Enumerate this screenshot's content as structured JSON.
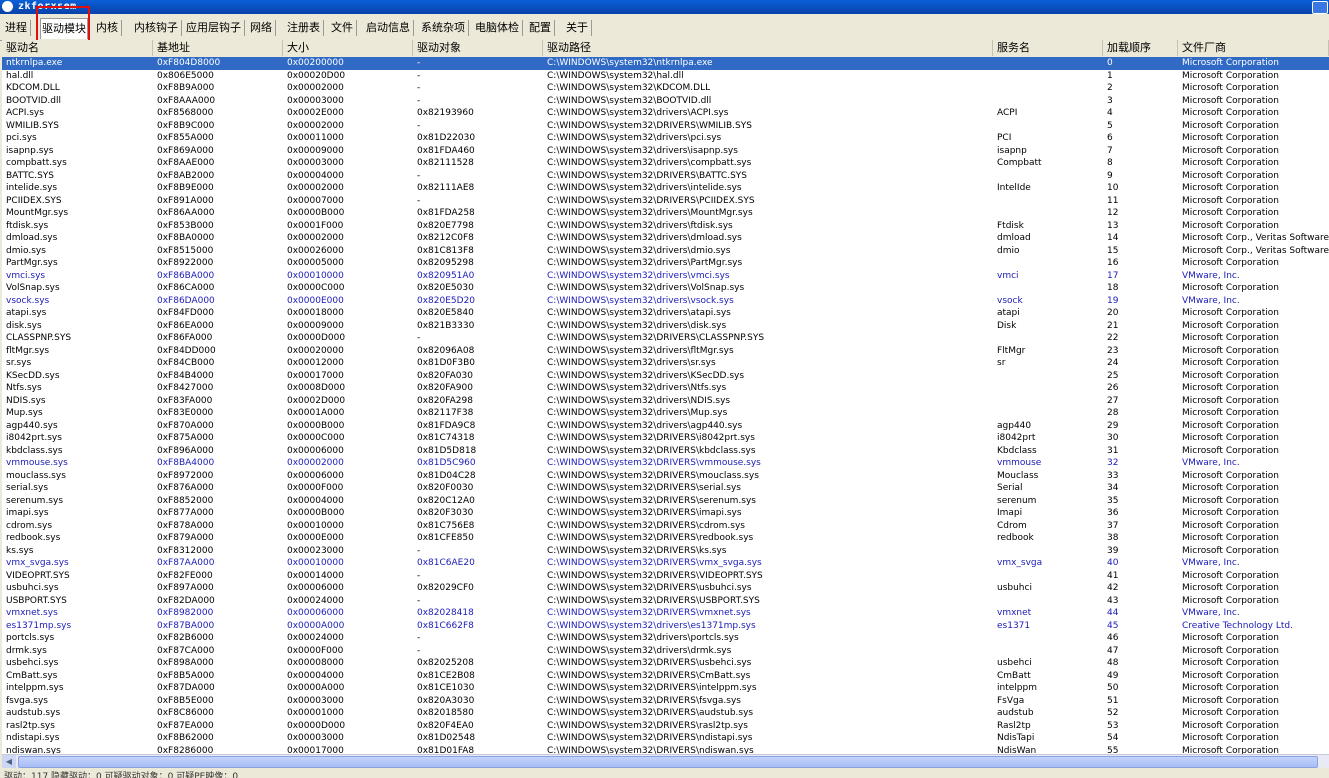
{
  "window": {
    "title": "zkforxsem"
  },
  "tabs": [
    "进程",
    "驱动模块",
    "内核",
    "内核钩子",
    "应用层钩子",
    "网络",
    "注册表",
    "文件",
    "启动信息",
    "系统杂项",
    "电脑体检",
    "配置",
    "关于"
  ],
  "active_tab": "驱动模块",
  "columns": [
    "驱动名",
    "基地址",
    "大小",
    "驱动对象",
    "驱动路径",
    "服务名",
    "加载顺序",
    "文件厂商"
  ],
  "rows": [
    [
      "ntkrnlpa.exe",
      "0xF804D8000",
      "0x00200000",
      "-",
      "C:\\WINDOWS\\system32\\ntkrnlpa.exe",
      "",
      "0",
      "Microsoft Corporation"
    ],
    [
      "hal.dll",
      "0x806E5000",
      "0x00020D00",
      "-",
      "C:\\WINDOWS\\system32\\hal.dll",
      "",
      "1",
      "Microsoft Corporation"
    ],
    [
      "KDCOM.DLL",
      "0xF8B9A000",
      "0x00002000",
      "-",
      "C:\\WINDOWS\\system32\\KDCOM.DLL",
      "",
      "2",
      "Microsoft Corporation"
    ],
    [
      "BOOTVID.dll",
      "0xF8AAA000",
      "0x00003000",
      "-",
      "C:\\WINDOWS\\system32\\BOOTVID.dll",
      "",
      "3",
      "Microsoft Corporation"
    ],
    [
      "ACPI.sys",
      "0xF8568000",
      "0x0002E000",
      "0x82193960",
      "C:\\WINDOWS\\system32\\drivers\\ACPI.sys",
      "ACPI",
      "4",
      "Microsoft Corporation"
    ],
    [
      "WMILIB.SYS",
      "0xF8B9C000",
      "0x00002000",
      "-",
      "C:\\WINDOWS\\system32\\DRIVERS\\WMILIB.SYS",
      "",
      "5",
      "Microsoft Corporation"
    ],
    [
      "pci.sys",
      "0xF855A000",
      "0x00011000",
      "0x81D22030",
      "C:\\WINDOWS\\system32\\drivers\\pci.sys",
      "PCI",
      "6",
      "Microsoft Corporation"
    ],
    [
      "isapnp.sys",
      "0xF869A000",
      "0x00009000",
      "0x81FDA460",
      "C:\\WINDOWS\\system32\\drivers\\isapnp.sys",
      "isapnp",
      "7",
      "Microsoft Corporation"
    ],
    [
      "compbatt.sys",
      "0xF8AAE000",
      "0x00003000",
      "0x82111528",
      "C:\\WINDOWS\\system32\\drivers\\compbatt.sys",
      "Compbatt",
      "8",
      "Microsoft Corporation"
    ],
    [
      "BATTC.SYS",
      "0xF8AB2000",
      "0x00004000",
      "-",
      "C:\\WINDOWS\\system32\\DRIVERS\\BATTC.SYS",
      "",
      "9",
      "Microsoft Corporation"
    ],
    [
      "intelide.sys",
      "0xF8B9E000",
      "0x00002000",
      "0x82111AE8",
      "C:\\WINDOWS\\system32\\drivers\\intelide.sys",
      "IntelIde",
      "10",
      "Microsoft Corporation"
    ],
    [
      "PCIIDEX.SYS",
      "0xF891A000",
      "0x00007000",
      "-",
      "C:\\WINDOWS\\system32\\DRIVERS\\PCIIDEX.SYS",
      "",
      "11",
      "Microsoft Corporation"
    ],
    [
      "MountMgr.sys",
      "0xF86AA000",
      "0x0000B000",
      "0x81FDA258",
      "C:\\WINDOWS\\system32\\drivers\\MountMgr.sys",
      "",
      "12",
      "Microsoft Corporation"
    ],
    [
      "ftdisk.sys",
      "0xF853B000",
      "0x0001F000",
      "0x820E7798",
      "C:\\WINDOWS\\system32\\drivers\\ftdisk.sys",
      "Ftdisk",
      "13",
      "Microsoft Corporation"
    ],
    [
      "dmload.sys",
      "0xF8BA0000",
      "0x00002000",
      "0x8212C0F8",
      "C:\\WINDOWS\\system32\\drivers\\dmload.sys",
      "dmload",
      "14",
      "Microsoft Corp., Veritas Software."
    ],
    [
      "dmio.sys",
      "0xF8515000",
      "0x00026000",
      "0x81C813F8",
      "C:\\WINDOWS\\system32\\drivers\\dmio.sys",
      "dmio",
      "15",
      "Microsoft Corp., Veritas Software"
    ],
    [
      "PartMgr.sys",
      "0xF8922000",
      "0x00005000",
      "0x82095298",
      "C:\\WINDOWS\\system32\\drivers\\PartMgr.sys",
      "",
      "16",
      "Microsoft Corporation"
    ],
    [
      "vmci.sys",
      "0xF86BA000",
      "0x00010000",
      "0x820951A0",
      "C:\\WINDOWS\\system32\\drivers\\vmci.sys",
      "vmci",
      "17",
      "VMware, Inc."
    ],
    [
      "VolSnap.sys",
      "0xF86CA000",
      "0x0000C000",
      "0x820E5030",
      "C:\\WINDOWS\\system32\\drivers\\VolSnap.sys",
      "",
      "18",
      "Microsoft Corporation"
    ],
    [
      "vsock.sys",
      "0xF86DA000",
      "0x0000E000",
      "0x820E5D20",
      "C:\\WINDOWS\\system32\\drivers\\vsock.sys",
      "vsock",
      "19",
      "VMware, Inc."
    ],
    [
      "atapi.sys",
      "0xF84FD000",
      "0x00018000",
      "0x820E5840",
      "C:\\WINDOWS\\system32\\drivers\\atapi.sys",
      "atapi",
      "20",
      "Microsoft Corporation"
    ],
    [
      "disk.sys",
      "0xF86EA000",
      "0x00009000",
      "0x821B3330",
      "C:\\WINDOWS\\system32\\drivers\\disk.sys",
      "Disk",
      "21",
      "Microsoft Corporation"
    ],
    [
      "CLASSPNP.SYS",
      "0xF86FA000",
      "0x0000D000",
      "-",
      "C:\\WINDOWS\\system32\\DRIVERS\\CLASSPNP.SYS",
      "",
      "22",
      "Microsoft Corporation"
    ],
    [
      "fltMgr.sys",
      "0xF84DD000",
      "0x00020000",
      "0x82096A08",
      "C:\\WINDOWS\\system32\\drivers\\fltMgr.sys",
      "FltMgr",
      "23",
      "Microsoft Corporation"
    ],
    [
      "sr.sys",
      "0xF84CB000",
      "0x00012000",
      "0x81D0F3B0",
      "C:\\WINDOWS\\system32\\drivers\\sr.sys",
      "sr",
      "24",
      "Microsoft Corporation"
    ],
    [
      "KSecDD.sys",
      "0xF84B4000",
      "0x00017000",
      "0x820FA030",
      "C:\\WINDOWS\\system32\\drivers\\KSecDD.sys",
      "",
      "25",
      "Microsoft Corporation"
    ],
    [
      "Ntfs.sys",
      "0xF8427000",
      "0x0008D000",
      "0x820FA900",
      "C:\\WINDOWS\\system32\\drivers\\Ntfs.sys",
      "",
      "26",
      "Microsoft Corporation"
    ],
    [
      "NDIS.sys",
      "0xF83FA000",
      "0x0002D000",
      "0x820FA298",
      "C:\\WINDOWS\\system32\\drivers\\NDIS.sys",
      "",
      "27",
      "Microsoft Corporation"
    ],
    [
      "Mup.sys",
      "0xF83E0000",
      "0x0001A000",
      "0x82117F38",
      "C:\\WINDOWS\\system32\\drivers\\Mup.sys",
      "",
      "28",
      "Microsoft Corporation"
    ],
    [
      "agp440.sys",
      "0xF870A000",
      "0x0000B000",
      "0x81FDA9C8",
      "C:\\WINDOWS\\system32\\drivers\\agp440.sys",
      "agp440",
      "29",
      "Microsoft Corporation"
    ],
    [
      "i8042prt.sys",
      "0xF875A000",
      "0x0000C000",
      "0x81C74318",
      "C:\\WINDOWS\\system32\\DRIVERS\\i8042prt.sys",
      "i8042prt",
      "30",
      "Microsoft Corporation"
    ],
    [
      "kbdclass.sys",
      "0xF896A000",
      "0x00006000",
      "0x81D5D818",
      "C:\\WINDOWS\\system32\\DRIVERS\\kbdclass.sys",
      "Kbdclass",
      "31",
      "Microsoft Corporation"
    ],
    [
      "vmmouse.sys",
      "0xF8BA4000",
      "0x00002000",
      "0x81D5C960",
      "C:\\WINDOWS\\system32\\DRIVERS\\vmmouse.sys",
      "vmmouse",
      "32",
      "VMware, Inc."
    ],
    [
      "mouclass.sys",
      "0xF8972000",
      "0x00006000",
      "0x81D04C28",
      "C:\\WINDOWS\\system32\\DRIVERS\\mouclass.sys",
      "Mouclass",
      "33",
      "Microsoft Corporation"
    ],
    [
      "serial.sys",
      "0xF876A000",
      "0x0000F000",
      "0x820F0030",
      "C:\\WINDOWS\\system32\\DRIVERS\\serial.sys",
      "Serial",
      "34",
      "Microsoft Corporation"
    ],
    [
      "serenum.sys",
      "0xF8852000",
      "0x00004000",
      "0x820C12A0",
      "C:\\WINDOWS\\system32\\DRIVERS\\serenum.sys",
      "serenum",
      "35",
      "Microsoft Corporation"
    ],
    [
      "imapi.sys",
      "0xF877A000",
      "0x0000B000",
      "0x820F3030",
      "C:\\WINDOWS\\system32\\DRIVERS\\imapi.sys",
      "Imapi",
      "36",
      "Microsoft Corporation"
    ],
    [
      "cdrom.sys",
      "0xF878A000",
      "0x00010000",
      "0x81C756E8",
      "C:\\WINDOWS\\system32\\DRIVERS\\cdrom.sys",
      "Cdrom",
      "37",
      "Microsoft Corporation"
    ],
    [
      "redbook.sys",
      "0xF879A000",
      "0x0000E000",
      "0x81CFE850",
      "C:\\WINDOWS\\system32\\DRIVERS\\redbook.sys",
      "redbook",
      "38",
      "Microsoft Corporation"
    ],
    [
      "ks.sys",
      "0xF8312000",
      "0x00023000",
      "-",
      "C:\\WINDOWS\\system32\\DRIVERS\\ks.sys",
      "",
      "39",
      "Microsoft Corporation"
    ],
    [
      "vmx_svga.sys",
      "0xF87AA000",
      "0x00010000",
      "0x81C6AE20",
      "C:\\WINDOWS\\system32\\DRIVERS\\vmx_svga.sys",
      "vmx_svga",
      "40",
      "VMware, Inc."
    ],
    [
      "VIDEOPRT.SYS",
      "0xF82FE000",
      "0x00014000",
      "-",
      "C:\\WINDOWS\\system32\\DRIVERS\\VIDEOPRT.SYS",
      "",
      "41",
      "Microsoft Corporation"
    ],
    [
      "usbuhci.sys",
      "0xF897A000",
      "0x00006000",
      "0x82029CF0",
      "C:\\WINDOWS\\system32\\DRIVERS\\usbuhci.sys",
      "usbuhci",
      "42",
      "Microsoft Corporation"
    ],
    [
      "USBPORT.SYS",
      "0xF82DA000",
      "0x00024000",
      "-",
      "C:\\WINDOWS\\system32\\DRIVERS\\USBPORT.SYS",
      "",
      "43",
      "Microsoft Corporation"
    ],
    [
      "vmxnet.sys",
      "0xF8982000",
      "0x00006000",
      "0x82028418",
      "C:\\WINDOWS\\system32\\DRIVERS\\vmxnet.sys",
      "vmxnet",
      "44",
      "VMware, Inc."
    ],
    [
      "es1371mp.sys",
      "0xF87BA000",
      "0x0000A000",
      "0x81C662F8",
      "C:\\WINDOWS\\system32\\drivers\\es1371mp.sys",
      "es1371",
      "45",
      "Creative Technology Ltd."
    ],
    [
      "portcls.sys",
      "0xF82B6000",
      "0x00024000",
      "-",
      "C:\\WINDOWS\\system32\\drivers\\portcls.sys",
      "",
      "46",
      "Microsoft Corporation"
    ],
    [
      "drmk.sys",
      "0xF87CA000",
      "0x0000F000",
      "-",
      "C:\\WINDOWS\\system32\\drivers\\drmk.sys",
      "",
      "47",
      "Microsoft Corporation"
    ],
    [
      "usbehci.sys",
      "0xF898A000",
      "0x00008000",
      "0x82025208",
      "C:\\WINDOWS\\system32\\DRIVERS\\usbehci.sys",
      "usbehci",
      "48",
      "Microsoft Corporation"
    ],
    [
      "CmBatt.sys",
      "0xF8B5A000",
      "0x00004000",
      "0x81CE2B08",
      "C:\\WINDOWS\\system32\\DRIVERS\\CmBatt.sys",
      "CmBatt",
      "49",
      "Microsoft Corporation"
    ],
    [
      "intelppm.sys",
      "0xF87DA000",
      "0x0000A000",
      "0x81CE1030",
      "C:\\WINDOWS\\system32\\DRIVERS\\intelppm.sys",
      "intelppm",
      "50",
      "Microsoft Corporation"
    ],
    [
      "fsvga.sys",
      "0xF8B5E000",
      "0x00003000",
      "0x820A3030",
      "C:\\WINDOWS\\system32\\DRIVERS\\fsvga.sys",
      "FsVga",
      "51",
      "Microsoft Corporation"
    ],
    [
      "audstub.sys",
      "0xF8C86000",
      "0x00001000",
      "0x82018580",
      "C:\\WINDOWS\\system32\\DRIVERS\\audstub.sys",
      "audstub",
      "52",
      "Microsoft Corporation"
    ],
    [
      "rasl2tp.sys",
      "0xF87EA000",
      "0x0000D000",
      "0x820F4EA0",
      "C:\\WINDOWS\\system32\\DRIVERS\\rasl2tp.sys",
      "Rasl2tp",
      "53",
      "Microsoft Corporation"
    ],
    [
      "ndistapi.sys",
      "0xF8B62000",
      "0x00003000",
      "0x81D02548",
      "C:\\WINDOWS\\system32\\DRIVERS\\ndistapi.sys",
      "NdisTapi",
      "54",
      "Microsoft Corporation"
    ],
    [
      "ndiswan.sys",
      "0xF8286000",
      "0x00017000",
      "0x81D01FA8",
      "C:\\WINDOWS\\system32\\DRIVERS\\ndiswan.sys",
      "NdisWan",
      "55",
      "Microsoft Corporation"
    ]
  ],
  "statusbar": "驱动：117  隐藏驱动：0  可疑驱动对象：0  可疑PE映像：0"
}
